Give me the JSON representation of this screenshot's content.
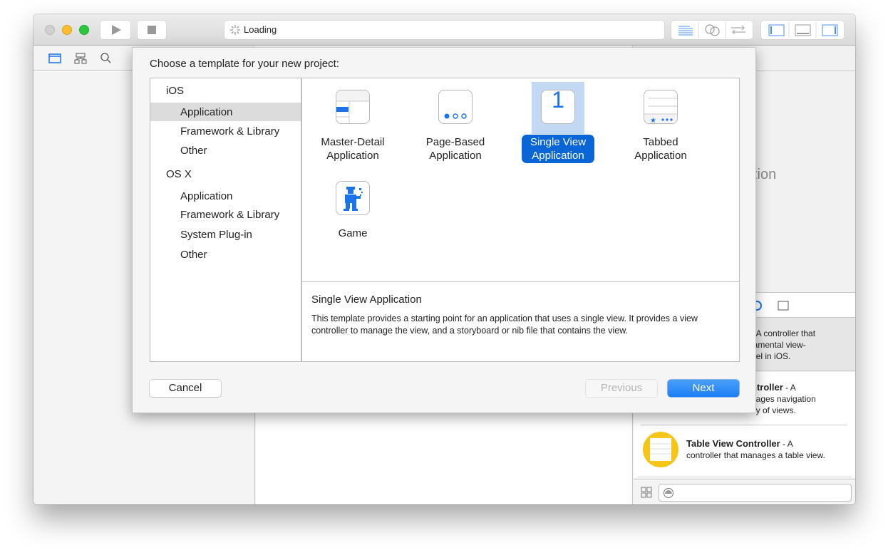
{
  "toolbar": {
    "status": "Loading",
    "icons": [
      "run-icon",
      "stop-icon",
      "standard-editor-icon",
      "assistant-editor-icon",
      "version-editor-icon",
      "navigator-toggle-icon",
      "debug-area-toggle-icon",
      "utilities-toggle-icon"
    ]
  },
  "inspector": {
    "placeholder_fragment": "ction"
  },
  "library": {
    "items": [
      {
        "title": "",
        "desc_lines": [
          "- A controller that",
          "lamental view-",
          "del in iOS."
        ]
      },
      {
        "title": "ntroller",
        "suffix": " - A",
        "desc_lines": [
          "nages navigation",
          "ny of views."
        ]
      },
      {
        "title": "Table View Controller",
        "suffix": " - A",
        "desc_lines": [
          "controller that manages a table view."
        ]
      }
    ]
  },
  "dialog": {
    "title": "Choose a template for your new project:",
    "categories": [
      {
        "label": "iOS",
        "header": true
      },
      {
        "label": "Application",
        "selected": true
      },
      {
        "label": "Framework & Library"
      },
      {
        "label": "Other"
      },
      {
        "label": "OS X",
        "header": true
      },
      {
        "label": "Application"
      },
      {
        "label": "Framework & Library"
      },
      {
        "label": "System Plug-in"
      },
      {
        "label": "Other"
      }
    ],
    "templates": [
      {
        "line1": "Master-Detail",
        "line2": "Application"
      },
      {
        "line1": "Page-Based",
        "line2": "Application"
      },
      {
        "line1": "Single View",
        "line2": "Application",
        "selected": true,
        "glyph": "1"
      },
      {
        "line1": "Tabbed",
        "line2": "Application"
      },
      {
        "line1": "Game",
        "line2": ""
      }
    ],
    "description": {
      "title": "Single View Application",
      "text": "This template provides a starting point for an application that uses a single view. It provides a view controller to manage the view, and a storyboard or nib file that contains the view."
    },
    "buttons": {
      "cancel": "Cancel",
      "previous": "Previous",
      "next": "Next"
    }
  },
  "colors": {
    "accent": "#0a66d6",
    "selection_bg": "#c3d9f3",
    "next_button": "#2b8cf8"
  }
}
